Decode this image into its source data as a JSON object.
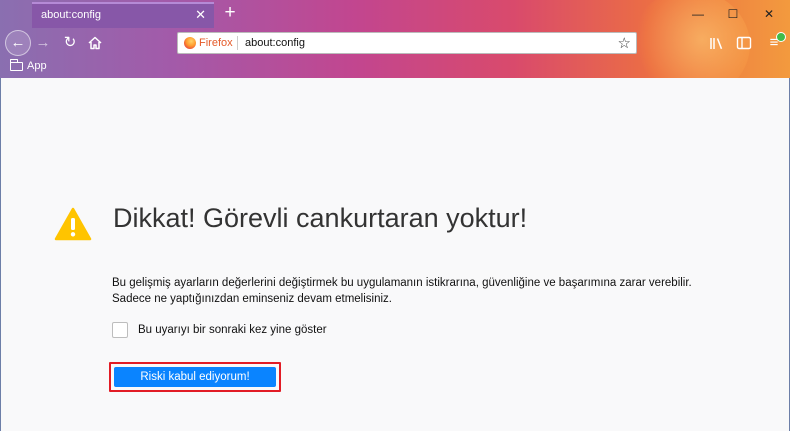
{
  "tab": {
    "title": "about:config",
    "close_glyph": "✕"
  },
  "new_tab_glyph": "+",
  "window_controls": {
    "minimize": "—",
    "maximize": "☐",
    "close": "✕"
  },
  "nav": {
    "back_icon": "arrow-left-icon",
    "forward_icon": "arrow-right-icon",
    "reload_icon": "reload-icon",
    "home_icon": "home-icon"
  },
  "urlbar": {
    "identity_label": "Firefox",
    "url": "about:config",
    "bookmark_icon": "star-icon"
  },
  "toolbar_right": {
    "library_icon": "library-icon",
    "sidebar_icon": "sidebar-icon",
    "menu_icon": "hamburger-menu-icon"
  },
  "bookmarks": {
    "items": [
      {
        "label": "App",
        "icon": "folder-icon"
      }
    ]
  },
  "page": {
    "heading": "Dikkat! Görevli cankurtaran yoktur!",
    "description_line1": "Bu gelişmiş ayarların değerlerini değiştirmek bu uygulamanın istikrarına, güvenliğine ve başarımına zarar verebilir.",
    "description_line2": "Sadece ne yaptığınızdan eminseniz devam etmelisiniz.",
    "checkbox_label": "Bu uyarıyı bir sonraki kez yine göster",
    "checkbox_checked": false,
    "accept_button": "Riski kabul ediyorum!"
  },
  "colors": {
    "accent": "#0a84ff",
    "highlight_border": "#e21c25",
    "warning": "#ffc400"
  }
}
